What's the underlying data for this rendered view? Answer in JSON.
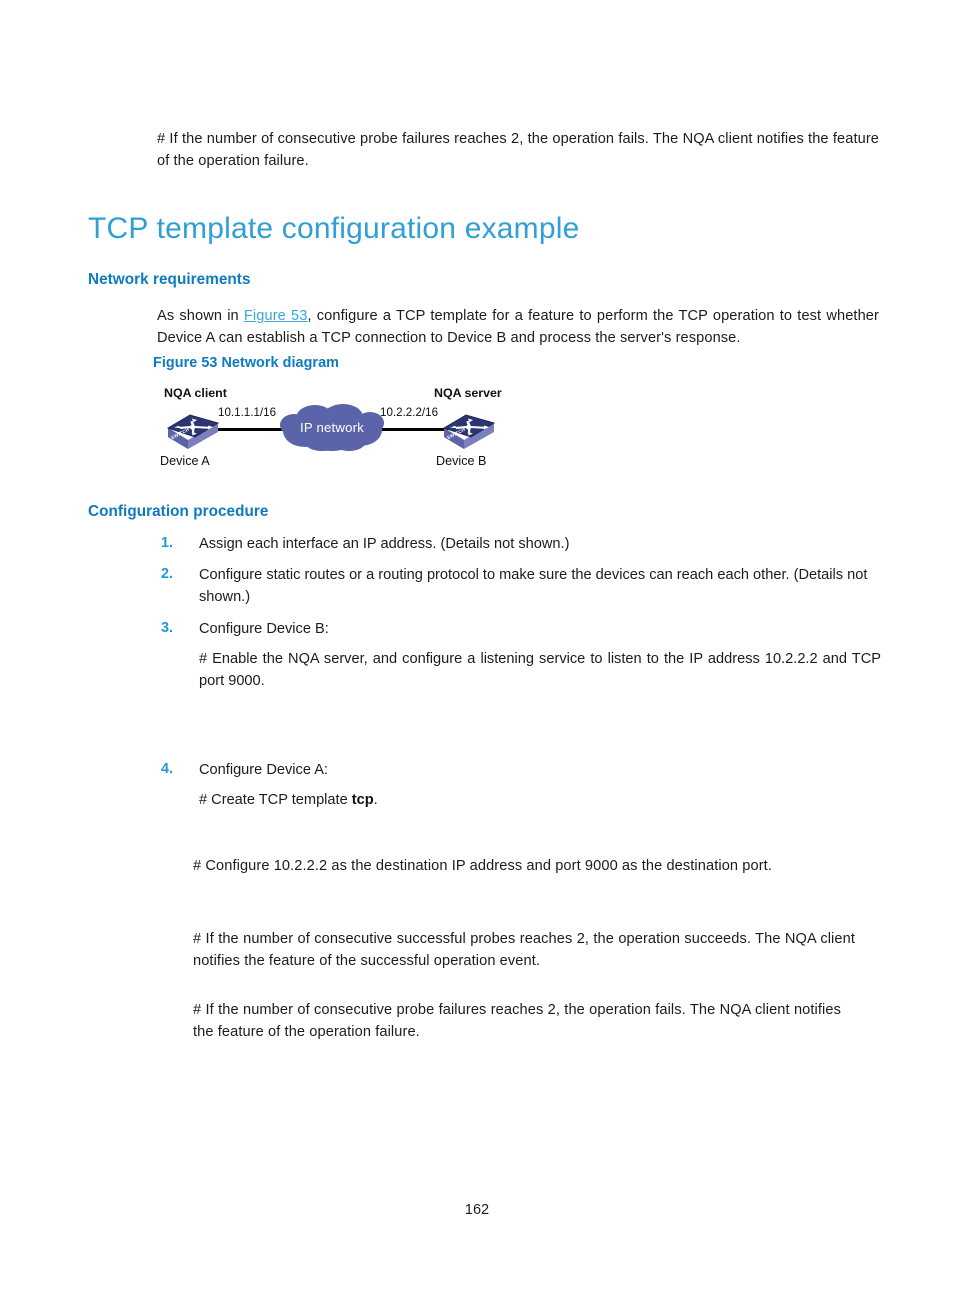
{
  "document": {
    "page_number": "162",
    "colors": {
      "heading_blue": "#2f9fd6",
      "subheading_blue": "#0e7bc0",
      "list_number_blue": "#1f9ad6",
      "xref_blue": "#3aa6dc",
      "cloud_fill": "#5b64a8",
      "switch_top": "#2b3570",
      "switch_side": "#7a7fbe",
      "body_text": "#1c1c1c"
    }
  },
  "intro": {
    "paragraph": "# If the number of consecutive probe failures reaches 2, the operation fails. The NQA client notifies the feature of the operation failure."
  },
  "heading": {
    "title": "TCP template configuration example"
  },
  "network_requirements": {
    "heading": "Network requirements",
    "text_before_xref": "As shown in ",
    "xref": "Figure 53",
    "text_after_xref": ", configure a TCP template for a feature to perform the TCP operation to test whether Device A can establish a TCP connection to Device B and process the server's response."
  },
  "figure": {
    "caption": "Figure 53 Network diagram",
    "left_role": "NQA client",
    "right_role": "NQA server",
    "left_ip": "10.1.1.1/16",
    "right_ip": "10.2.2.2/16",
    "left_device": "Device A",
    "right_device": "Device B",
    "cloud_label": "IP network",
    "switch_badge": "SWITCH"
  },
  "configuration_procedure": {
    "heading": "Configuration procedure",
    "steps": [
      {
        "number": "1.",
        "text": "Assign each interface an IP address. (Details not shown.)",
        "sub": ""
      },
      {
        "number": "2.",
        "text": "Configure static routes or a routing protocol to make sure the devices can reach each other. (Details not shown.)",
        "sub": ""
      },
      {
        "number": "3.",
        "text": "Configure Device B:",
        "sub": "# Enable the NQA server, and configure a listening service to listen to the IP address 10.2.2.2 and TCP port 9000."
      },
      {
        "number": "4.",
        "text": "Configure Device A:",
        "sub_prefix": "# Create TCP template ",
        "sub_bold": "tcp",
        "sub_suffix": "."
      }
    ],
    "trailing_paragraphs": [
      "# Configure 10.2.2.2 as the destination IP address and port 9000 as the destination port.",
      "# If the number of consecutive successful probes reaches 2, the operation succeeds. The NQA client notifies the feature of the successful operation event.",
      "# If the number of consecutive probe failures reaches 2, the operation fails. The NQA client notifies the feature of the operation failure."
    ]
  }
}
